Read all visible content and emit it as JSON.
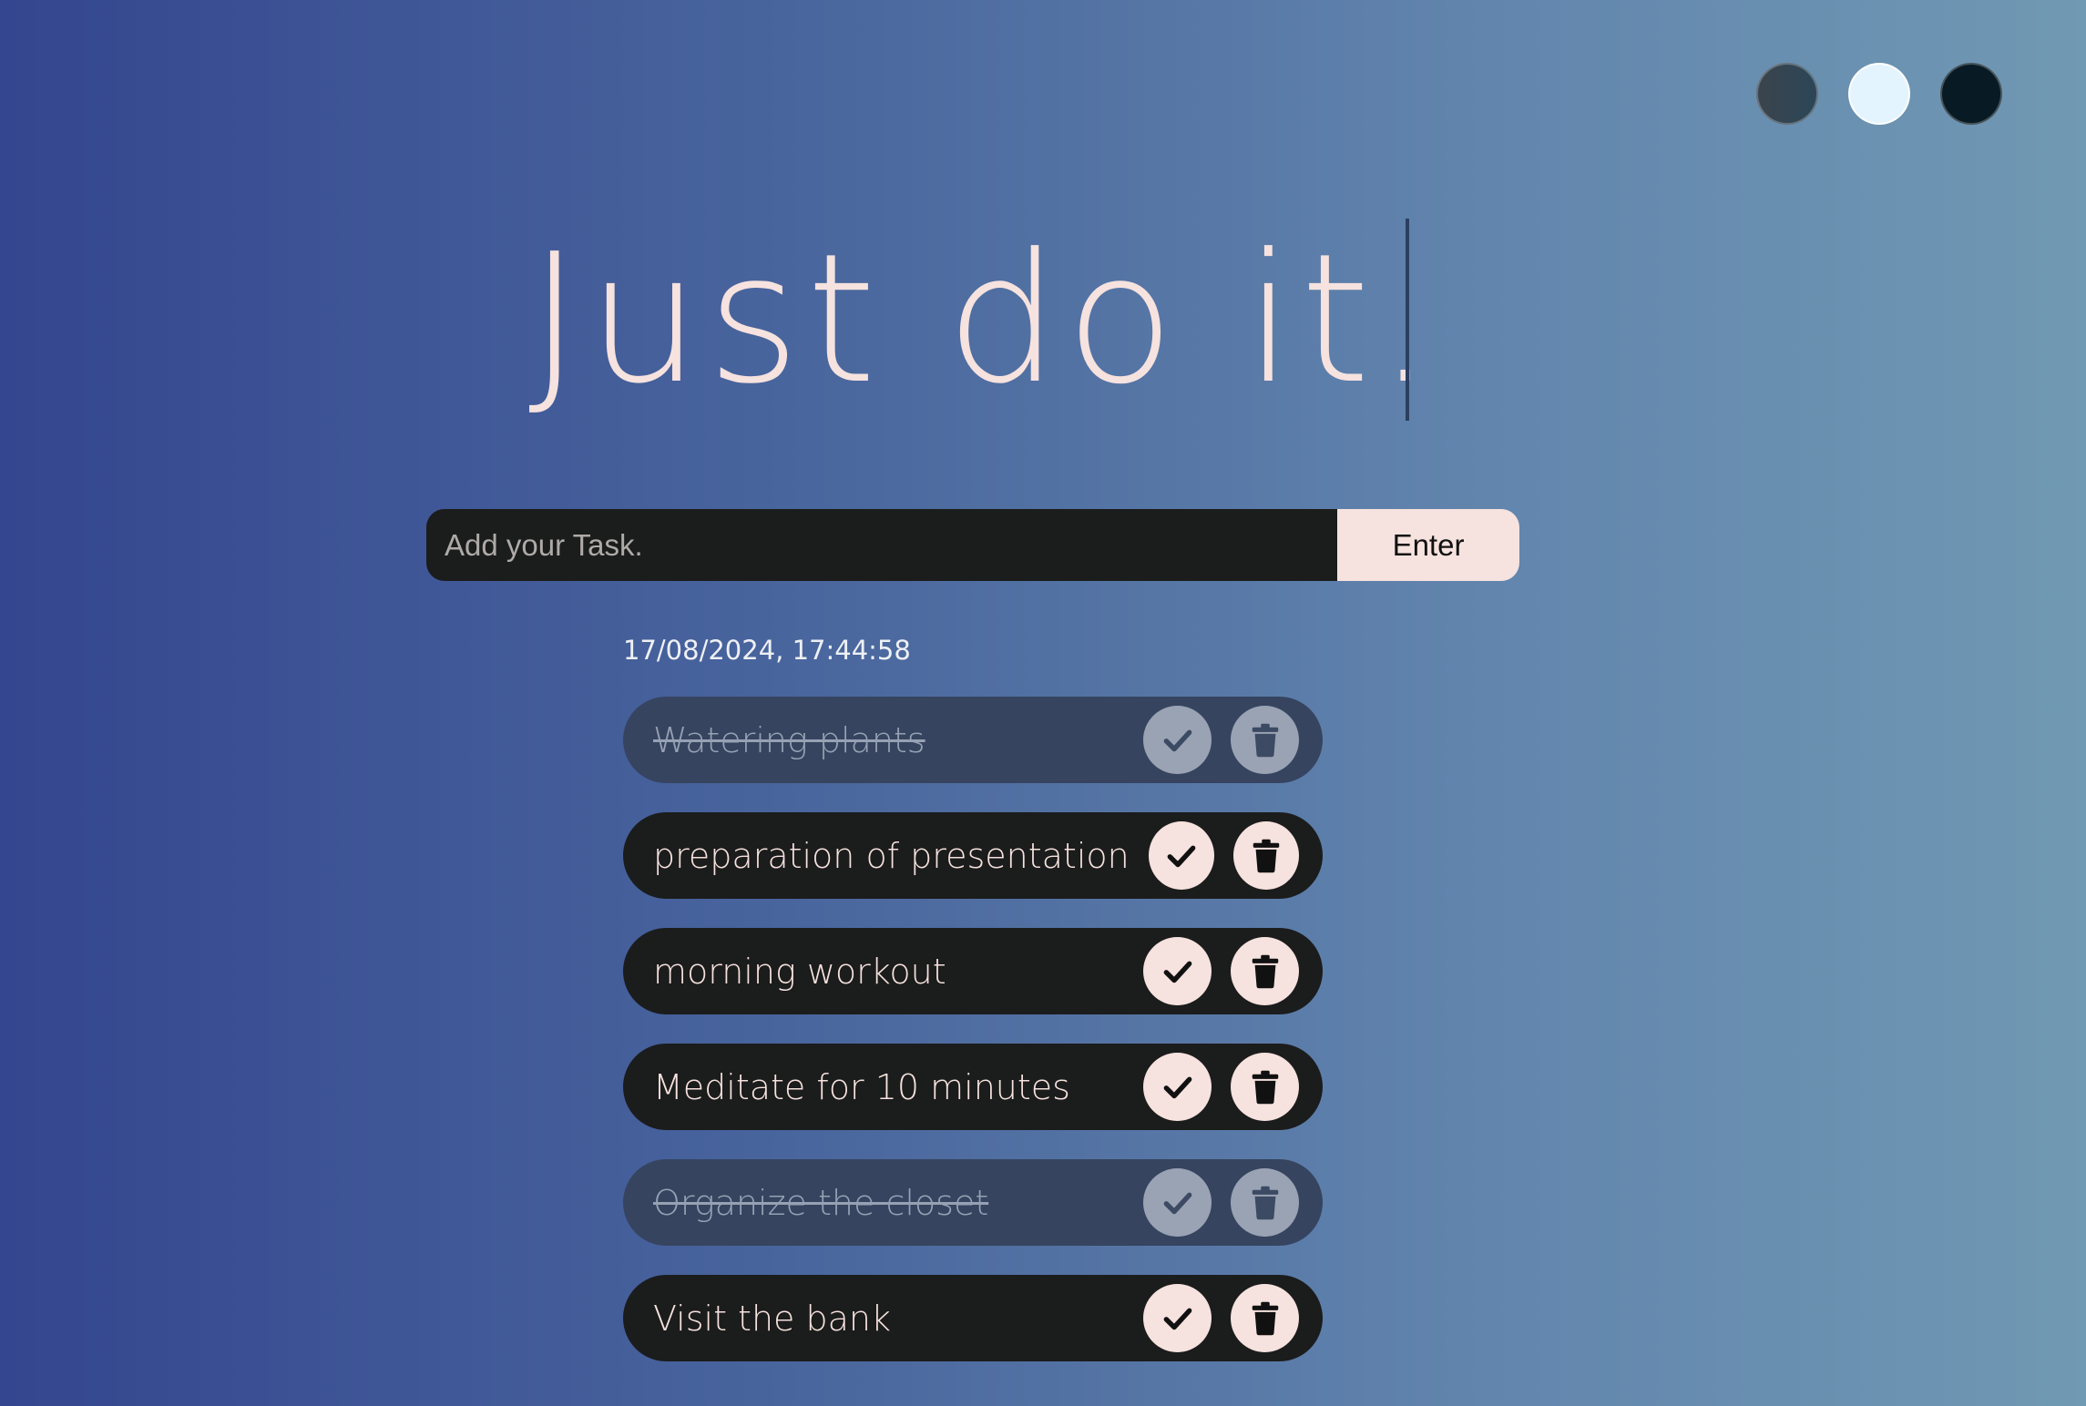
{
  "theme_switcher": {
    "options": [
      {
        "name": "dark-slate",
        "color": "#3b444c"
      },
      {
        "name": "light-ice",
        "color": "#e4f4fe"
      },
      {
        "name": "deep-navy",
        "color": "#081a23"
      }
    ]
  },
  "header": {
    "title": "Just do it."
  },
  "form": {
    "placeholder": "Add your Task.",
    "submit_label": "Enter"
  },
  "datetime": "17/08/2024, 17:44:58",
  "tasks": [
    {
      "text": "Watering plants",
      "completed": true
    },
    {
      "text": "preparation of presentation",
      "completed": false
    },
    {
      "text": "morning workout",
      "completed": false
    },
    {
      "text": "Meditate for 10 minutes",
      "completed": false
    },
    {
      "text": "Organize the closet",
      "completed": true
    },
    {
      "text": "Visit the bank",
      "completed": false
    }
  ],
  "icons": {
    "complete": "check-icon",
    "delete": "trash-icon"
  },
  "colors": {
    "accent": "#f6e2de",
    "task_background": "#1b1c1c",
    "completed_task_background": "#36445f"
  }
}
